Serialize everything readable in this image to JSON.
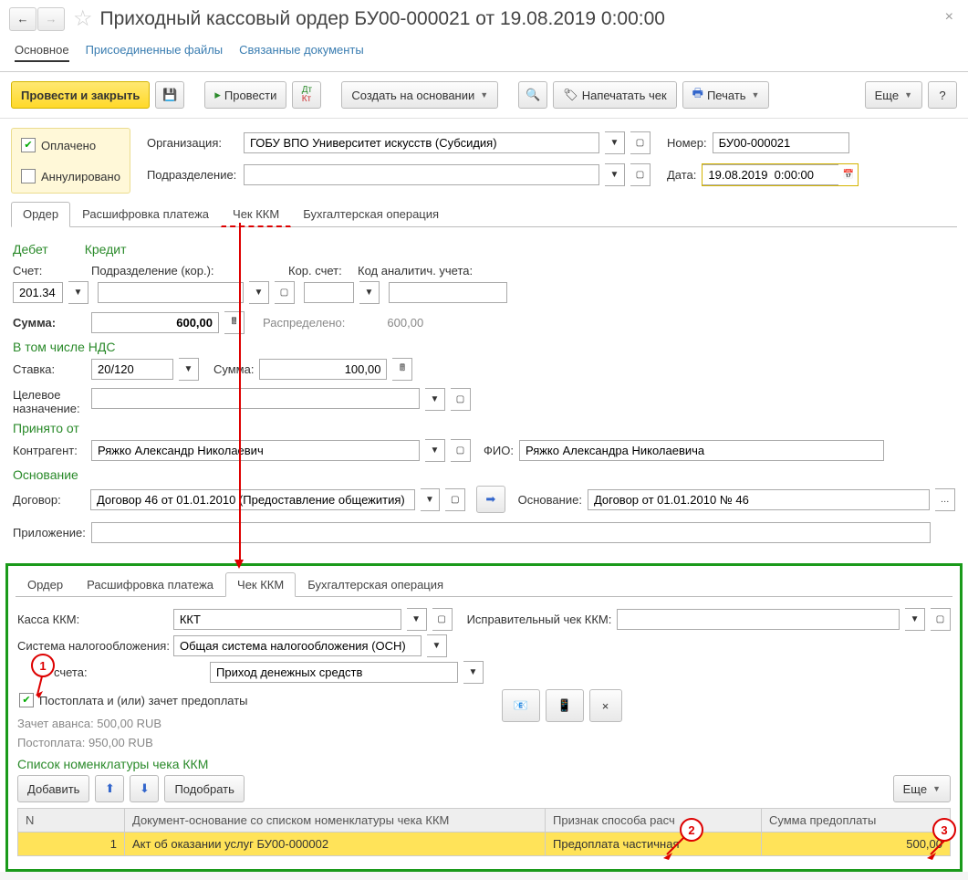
{
  "title": "Приходный кассовый ордер БУ00-000021 от 19.08.2019 0:00:00",
  "navTabs": {
    "main": "Основное",
    "files": "Присоединенные файлы",
    "linked": "Связанные документы"
  },
  "toolbar": {
    "post_close": "Провести и закрыть",
    "post": "Провести",
    "create_on": "Создать на основании",
    "print_receipt": "Напечатать чек",
    "print": "Печать",
    "more": "Еще",
    "help": "?"
  },
  "status": {
    "paid": "Оплачено",
    "cancelled": "Аннулировано"
  },
  "header": {
    "org_lbl": "Организация:",
    "org": "ГОБУ ВПО Университет искусств (Субсидия)",
    "num_lbl": "Номер:",
    "num": "БУ00-000021",
    "dept_lbl": "Подразделение:",
    "dept": "",
    "date_lbl": "Дата:",
    "date": "19.08.2019  0:00:00"
  },
  "innerTabs": {
    "order": "Ордер",
    "decode": "Расшифровка платежа",
    "kkm": "Чек ККМ",
    "acc": "Бухгалтерская операция"
  },
  "order": {
    "debit": "Дебет",
    "credit": "Кредит",
    "acct_lbl": "Счет:",
    "acct": "201.34",
    "dept_kor_lbl": "Подразделение (кор.):",
    "kor_acct_lbl": "Кор. счет:",
    "analytic_lbl": "Код аналитич. учета:",
    "sum_lbl": "Сумма:",
    "sum": "600,00",
    "dist_lbl": "Распределено:",
    "dist": "600,00",
    "vat_h": "В том числе НДС",
    "rate_lbl": "Ставка:",
    "rate": "20/120",
    "vat_sum_lbl": "Сумма:",
    "vat_sum": "100,00",
    "target_lbl": "Целевое\nназначение:",
    "from_h": "Принято от",
    "contr_lbl": "Контрагент:",
    "contr": "Ряжко Александр Николаевич",
    "fio_lbl": "ФИО:",
    "fio": "Ряжко Александра Николаевича",
    "basis_h": "Основание",
    "dog_lbl": "Договор:",
    "dog": "Договор 46 от 01.01.2010 (Предоставление общежития)",
    "basis_lbl": "Основание:",
    "basis": "Договор от 01.01.2010 № 46",
    "app_lbl": "Приложение:"
  },
  "kkm": {
    "kkm_lbl": "Касса ККМ:",
    "kkm": "ККТ",
    "corr_lbl": "Исправительный чек ККМ:",
    "tax_lbl": "Система налогообложения:",
    "tax": "Общая система налогообложения (ОСН)",
    "pay_lbl": "Признак расчета:",
    "pay": "Приход денежных средств",
    "postpay_chk": "Постоплата и (или) зачет предоплаты",
    "advance": "Зачет аванса: 500,00 RUB",
    "postpay": "Постоплата: 950,00 RUB",
    "list_h": "Список номенклатуры чека ККМ",
    "add": "Добавить",
    "pick": "Подобрать",
    "more": "Еще",
    "col_n": "N",
    "col_doc": "Документ-основание со списком номенклатуры чека ККМ",
    "col_sign": "Признак способа расч",
    "col_sum": "Сумма предоплаты",
    "rows": [
      {
        "n": "1",
        "doc": "Акт об оказании услуг БУ00-000002",
        "sign": "Предоплата частичная",
        "sum": "500,00"
      }
    ]
  },
  "callouts": {
    "c1": "1",
    "c2": "2",
    "c3": "3"
  }
}
